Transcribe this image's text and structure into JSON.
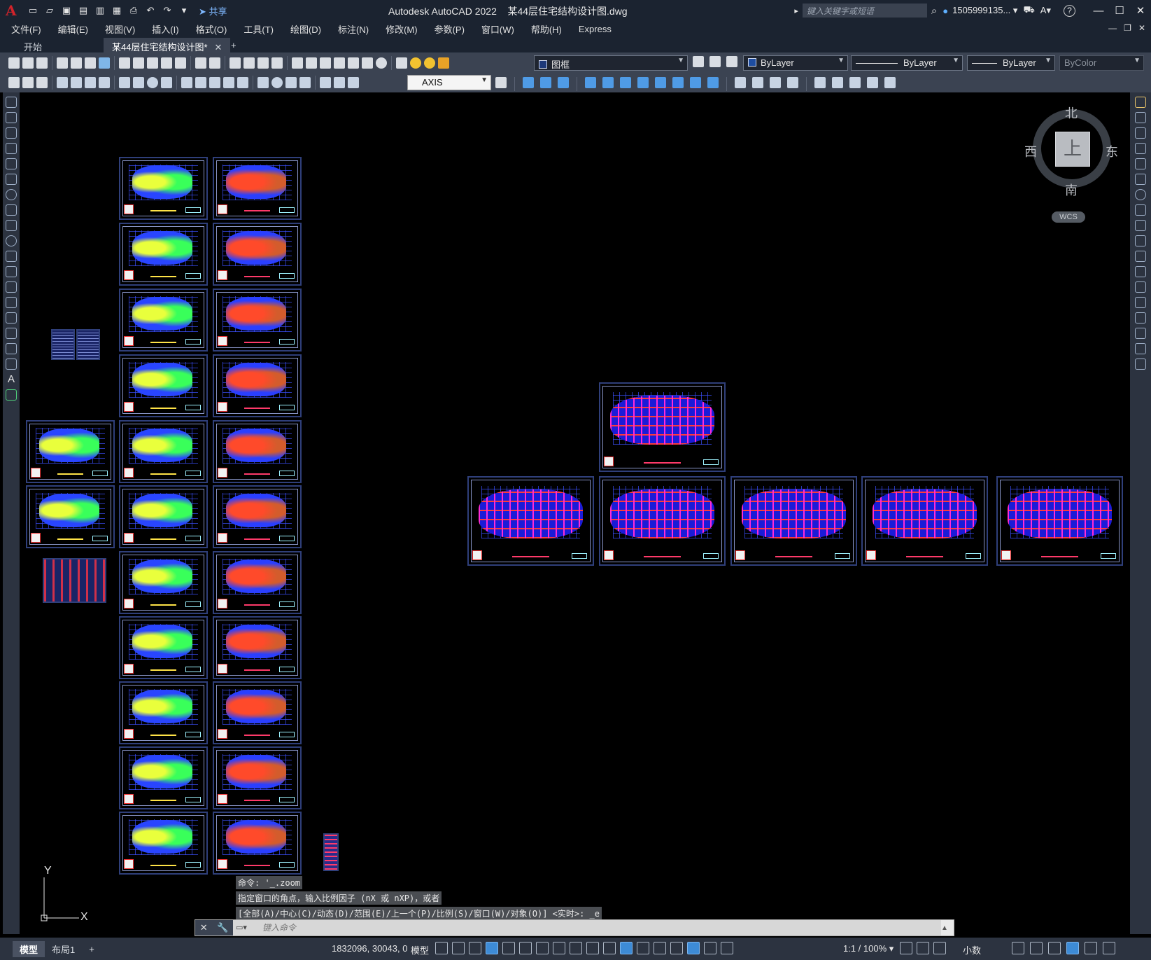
{
  "app": {
    "logo": "A",
    "title": "Autodesk AutoCAD 2022",
    "file": "某44层住宅结构设计图.dwg",
    "share_label": "共享",
    "search_placeholder": "键入关键字或短语",
    "user": "1505999135... ▾",
    "help_label": "?"
  },
  "menu": [
    "文件(F)",
    "编辑(E)",
    "视图(V)",
    "插入(I)",
    "格式(O)",
    "工具(T)",
    "绘图(D)",
    "标注(N)",
    "修改(M)",
    "参数(P)",
    "窗口(W)",
    "帮助(H)",
    "Express"
  ],
  "tabs": {
    "start": "开始",
    "active": "某44层住宅结构设计图*",
    "add": "+"
  },
  "toolbar": {
    "layer": "图框",
    "color": "ByLayer",
    "linetype": "ByLayer",
    "lineweight": "ByLayer",
    "plotstyle": "ByColor",
    "dimstyle": "AXIS"
  },
  "viewcube": {
    "north": "北",
    "south": "南",
    "east": "东",
    "west": "西",
    "top": "上",
    "wcs": "WCS"
  },
  "ucs": {
    "x": "X",
    "y": "Y"
  },
  "command": {
    "history": [
      "命令: '_.zoom",
      "指定窗口的角点，输入比例因子 (nX 或 nXP)，或者",
      "[全部(A)/中心(C)/动态(D)/范围(E)/上一个(P)/比例(S)/窗口(W)/对象(O)] <实时>: _e"
    ],
    "placeholder": "键入命令"
  },
  "status": {
    "layout_tabs": [
      "模型",
      "布局1"
    ],
    "add_layout": "+",
    "coords": "1832096, 30043, 0",
    "model": "模型",
    "scale": "1:1 / 100% ▾",
    "units": "小数"
  }
}
